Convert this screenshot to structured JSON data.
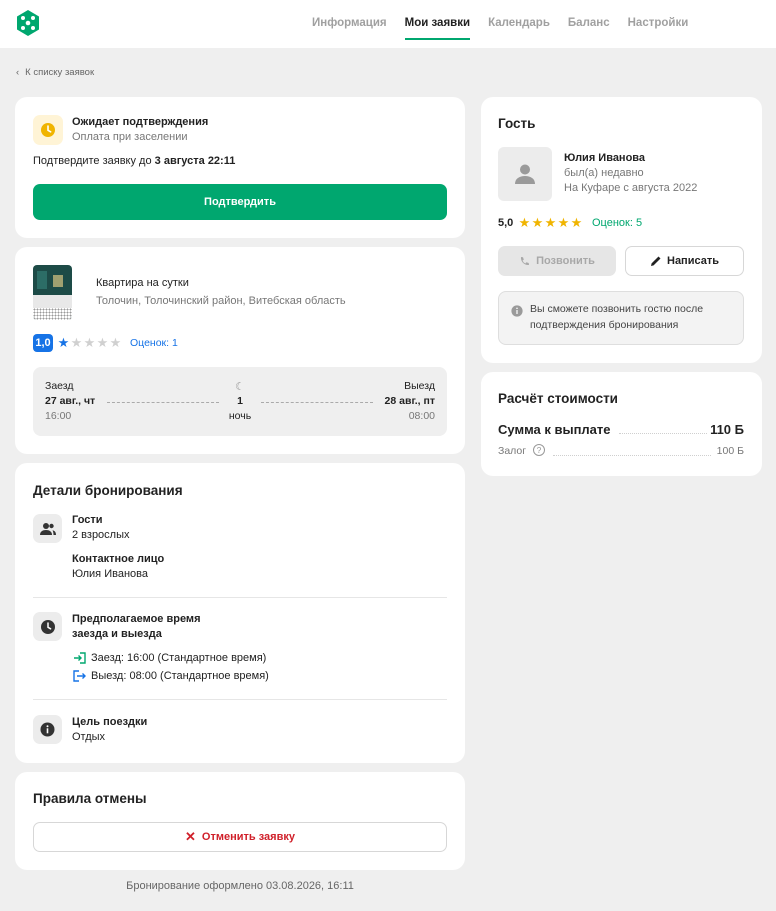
{
  "nav": {
    "items": [
      "Информация",
      "Мои заявки",
      "Календарь",
      "Баланс",
      "Настройки"
    ],
    "active_index": 1
  },
  "back_link": "К списку заявок",
  "status_card": {
    "title": "Ожидает подтверждения",
    "subtitle": "Оплата при заселении",
    "confirm_prefix": "Подтвердите заявку до",
    "confirm_deadline": "3 августа 22:11",
    "confirm_button": "Подтвердить"
  },
  "listing": {
    "title": "Квартира на сутки",
    "location": "Толочин, Толочинский район, Витебская область",
    "rating": "1,0",
    "rating_stars": 1,
    "reviews": "Оценок: 1",
    "checkin_label": "Заезд",
    "checkin_date": "27 авг., чт",
    "checkin_time": "16:00",
    "nights": "1",
    "nights_label": "ночь",
    "checkout_label": "Выезд",
    "checkout_date": "28 авг., пт",
    "checkout_time": "08:00"
  },
  "details": {
    "heading": "Детали бронирования",
    "guests_label": "Гости",
    "guests_value": "2 взрослых",
    "contact_label": "Контактное лицо",
    "contact_value": "Юлия Иванова",
    "time_label_1": "Предполагаемое время",
    "time_label_2": "заезда и выезда",
    "checkin_line": "Заезд: 16:00 (Стандартное время)",
    "checkout_line": "Выезд: 08:00 (Стандартное время)",
    "purpose_label": "Цель поездки",
    "purpose_value": "Отдых"
  },
  "cancel": {
    "heading": "Правила отмены",
    "button": "Отменить заявку"
  },
  "footer_note": "Бронирование оформлено 03.08.2026, 16:11",
  "guest": {
    "heading": "Гость",
    "name": "Юлия Иванова",
    "last_seen": "был(а) недавно",
    "member_since": "На Куфаре с августа 2022",
    "rating": "5,0",
    "rating_stars": 5,
    "reviews": "Оценок: 5",
    "call_button": "Позвонить",
    "message_button": "Написать",
    "info_text_1": "Вы сможете позвонить гостю после",
    "info_text_2": "подтверждения бронирования"
  },
  "cost": {
    "heading": "Расчёт стоимости",
    "total_label": "Сумма к выплате",
    "total_value": "110 Б",
    "deposit_label": "Залог",
    "deposit_value": "100 Б"
  },
  "colors": {
    "accent_green": "#00a76f",
    "star_gold": "#f0b400",
    "link_blue": "#1673e6",
    "cancel_red": "#d0202a"
  },
  "icons": [
    "logo-icon",
    "chevron-left-icon",
    "clock-icon",
    "moon-icon",
    "users-icon",
    "time-icon",
    "enter-icon",
    "exit-icon",
    "info-icon",
    "phone-icon",
    "pencil-icon",
    "close-icon",
    "help-icon",
    "avatar-icon"
  ]
}
